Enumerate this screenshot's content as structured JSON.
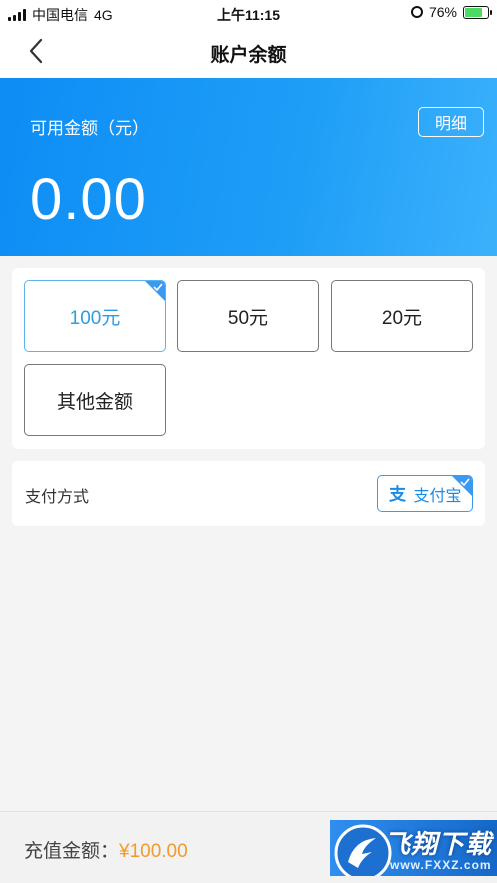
{
  "status_bar": {
    "carrier": "中国电信",
    "network": "4G",
    "time": "上午11:15",
    "battery": "76%",
    "battery_level": 0.76
  },
  "nav": {
    "title": "账户余额"
  },
  "balance": {
    "label": "可用金额（元）",
    "amount": "0.00",
    "detail_button": "明细"
  },
  "amount_options": [
    {
      "label": "100元",
      "selected": true
    },
    {
      "label": "50元",
      "selected": false
    },
    {
      "label": "20元",
      "selected": false
    },
    {
      "label": "其他金额",
      "selected": false
    }
  ],
  "payment": {
    "label": "支付方式",
    "method": "支付宝",
    "method_icon": "alipay-icon"
  },
  "bottom": {
    "total_label": "充值金额：",
    "total_value": "¥100.00"
  },
  "watermark": {
    "text": "飞翔下载",
    "url": "www.FXXZ.com"
  },
  "colors": {
    "accent": "#1a8be6",
    "price": "#f39a2b",
    "header_gradient_start": "#0d8df5",
    "header_gradient_end": "#3bb1fb"
  }
}
